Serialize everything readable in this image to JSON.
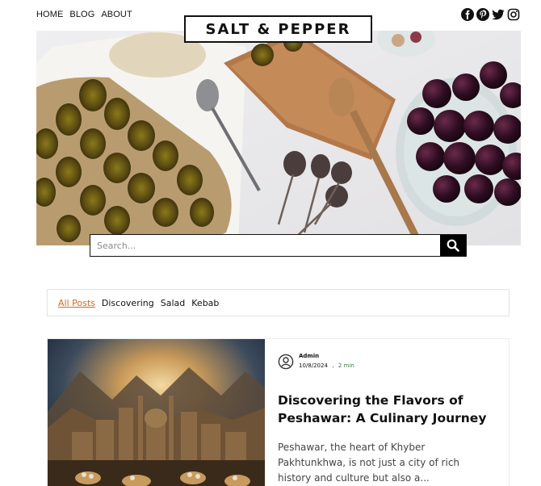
{
  "nav": {
    "items": [
      "HOME",
      "BLOG",
      "ABOUT"
    ]
  },
  "site": {
    "title": "SALT & PEPPER"
  },
  "social": {
    "icons": [
      "facebook-icon",
      "pinterest-icon",
      "twitter-icon",
      "instagram-icon"
    ]
  },
  "search": {
    "placeholder": "Search..."
  },
  "categories": {
    "items": [
      "All Posts",
      "Discovering",
      "Salad",
      "Kebab"
    ],
    "active": "All Posts"
  },
  "post": {
    "author": "Admin",
    "date": "10/8/2024",
    "separator": ".",
    "read_time": "2 min",
    "title": "Discovering the Flavors of Peshawar: A Culinary Journey",
    "excerpt": "Peshawar, the heart of Khyber Pakhtunkhwa, is not just a city of rich history and culture but also a..."
  },
  "colors": {
    "accent": "#d2691e",
    "read_time": "#2e7d32",
    "border": "#111111"
  }
}
